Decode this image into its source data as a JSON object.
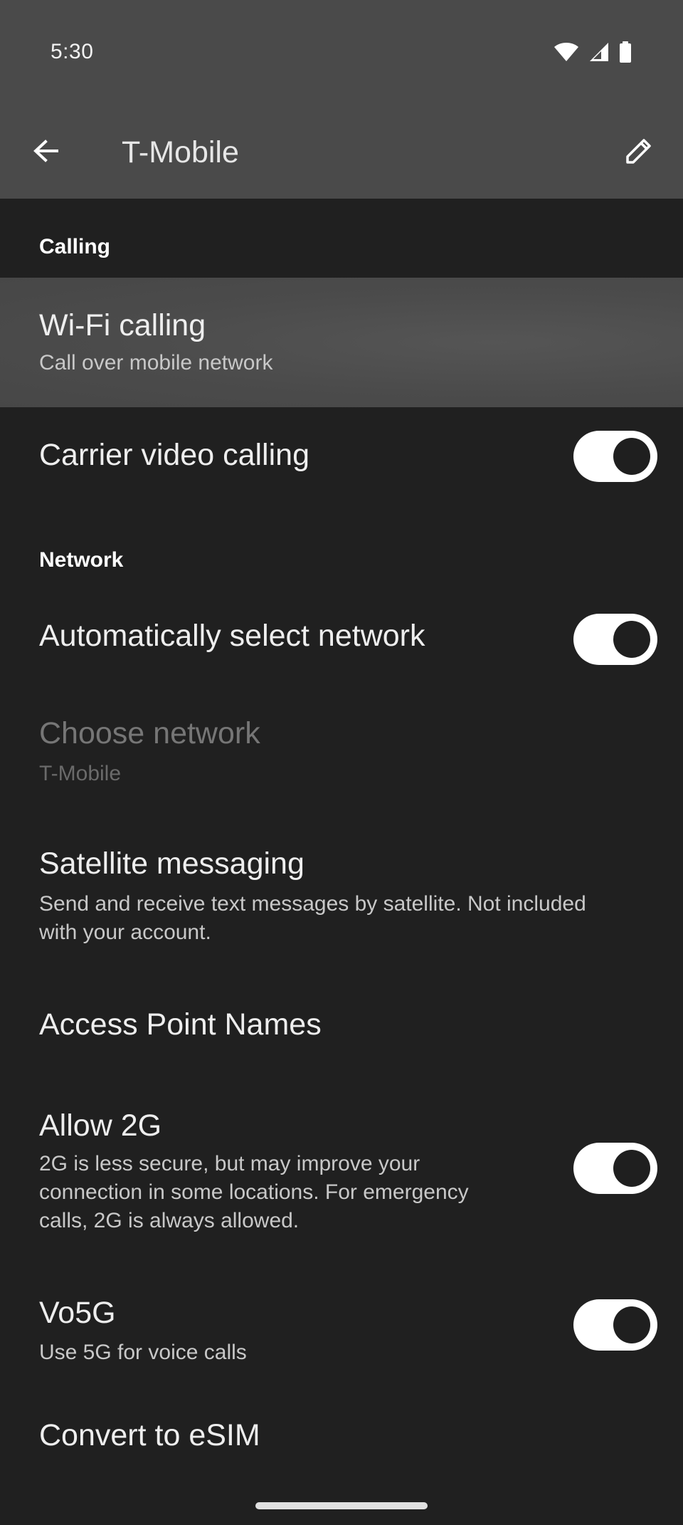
{
  "status_bar": {
    "time": "5:30",
    "icons": [
      "wifi-icon",
      "signal-icon",
      "battery-icon"
    ]
  },
  "app_bar": {
    "title": "T-Mobile",
    "back_icon": "arrow-back-icon",
    "edit_icon": "pencil-icon"
  },
  "sections": {
    "calling": "Calling",
    "network": "Network"
  },
  "items": {
    "wifi_calling": {
      "title": "Wi-Fi calling",
      "subtitle": "Call over mobile network"
    },
    "carrier_video_calling": {
      "title": "Carrier video calling",
      "toggle": true
    },
    "auto_select_network": {
      "title": "Automatically select network",
      "toggle": true
    },
    "choose_network": {
      "title": "Choose network",
      "subtitle": "T-Mobile",
      "disabled": true
    },
    "satellite_messaging": {
      "title": "Satellite messaging",
      "subtitle_line1": "Send and receive text messages by satellite. Not included",
      "subtitle_line2": "with your account."
    },
    "access_point_names": {
      "title": "Access Point Names"
    },
    "allow_2g": {
      "title": "Allow 2G",
      "subtitle_line1": "2G is less secure, but may improve your",
      "subtitle_line2": "connection in some locations. For emergency",
      "subtitle_line3": "calls, 2G is always allowed.",
      "toggle": true
    },
    "vo5g": {
      "title": "Vo5G",
      "subtitle": "Use 5G for voice calls",
      "toggle": true
    },
    "convert_esim": {
      "title": "Convert to eSIM"
    }
  },
  "colors": {
    "background": "#202020",
    "appbar": "#4a4a4a",
    "toggle_track": "#ffffff",
    "toggle_knob": "#1f1f1f"
  }
}
